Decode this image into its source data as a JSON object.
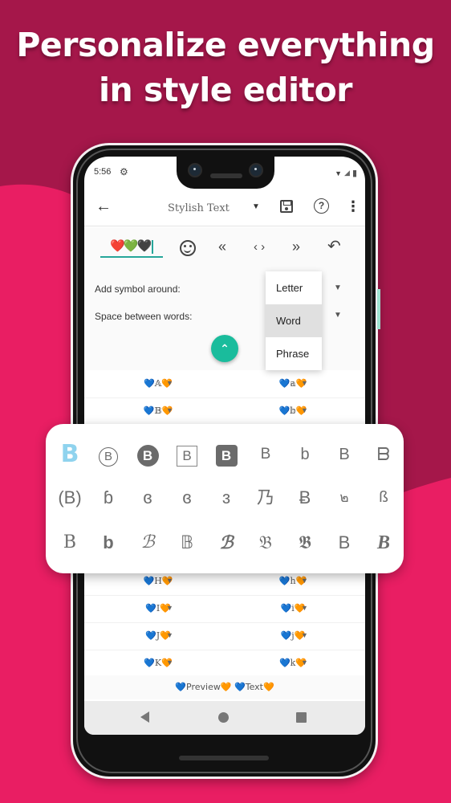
{
  "headline": {
    "line1": "Personalize everything",
    "line2": "in style editor"
  },
  "colors": {
    "background": "#A5174A",
    "accent_pink": "#E91E63",
    "teal": "#1ABC9C",
    "cyan_glyph": "#8FD3EE"
  },
  "status_bar": {
    "time": "5:56",
    "gear_icon": "⚙",
    "wifi_icon": "▼",
    "signal_icon": "◢",
    "battery_icon": "▮"
  },
  "toolbar": {
    "back_icon": "←",
    "title": "Stylish Text",
    "title_caret": "▼",
    "save_icon": "save-icon",
    "help_icon": "?",
    "more_icon": "⋮"
  },
  "editor": {
    "input_value": "❤️💚🖤",
    "emoji_icon": "emoji-icon",
    "prev_icon": "«",
    "code_icon": "‹ ›",
    "next_icon": "»",
    "undo_icon": "↶"
  },
  "settings": {
    "symbol_around_label": "Add symbol around:",
    "space_between_label": "Space between words:",
    "caret": "▼",
    "fab_icon": "⌃"
  },
  "dropdown": {
    "options": [
      {
        "label": "Letter",
        "selected": false
      },
      {
        "label": "Word",
        "selected": true
      },
      {
        "label": "Phrase",
        "selected": false
      }
    ]
  },
  "rows_top": [
    {
      "left": "💙𝔸🧡",
      "right": "💙𝕒🧡"
    },
    {
      "left": "💙𝔹🧡",
      "right": "💙𝕓🧡"
    }
  ],
  "rows_bottom": [
    {
      "left": "💙H🧡",
      "right": "💙h🧡"
    },
    {
      "left": "💙I🧡",
      "right": "💙i🧡"
    },
    {
      "left": "💙J🧡",
      "right": "💙j🧡"
    },
    {
      "left": "💙K🧡",
      "right": "💙k🧡"
    }
  ],
  "row_caret": "▼",
  "preview": "💙Preview🧡 💙Text🧡",
  "style_picker": {
    "rows": [
      [
        "B",
        "B",
        "B",
        "B",
        "B",
        "B",
        "b",
        "B",
        "ᗷ"
      ],
      [
        "(B)",
        "ɓ",
        "ɞ",
        "ɞ",
        "ɜ",
        "乃",
        "Ƀ",
        "๒",
        "ß"
      ],
      [
        "B",
        "b",
        "ℬ",
        "𝔹",
        "ℬ",
        "𝔅",
        "𝕭",
        "B",
        "B"
      ]
    ]
  },
  "nav_bar": {
    "back_icon": "◀",
    "home_icon": "●",
    "recents_icon": "■"
  }
}
